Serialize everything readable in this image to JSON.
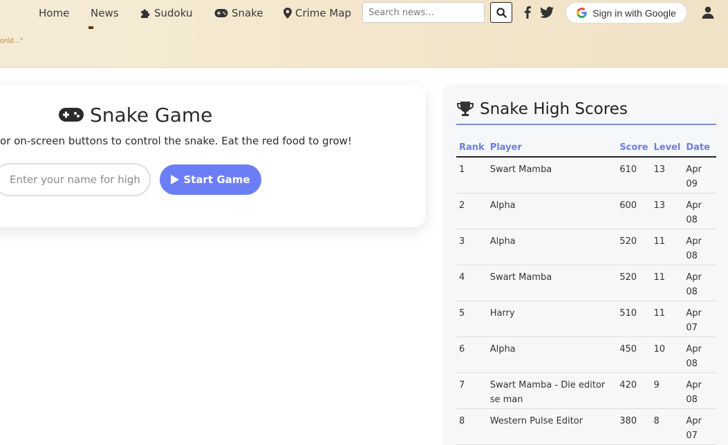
{
  "nav": {
    "home": "Home",
    "news": "News",
    "sudoku": "Sudoku",
    "snake": "Snake",
    "crime_map": "Crime Map",
    "tagline": "orld...\"",
    "search_placeholder": "Search news...",
    "google_signin": "Sign in with Google"
  },
  "game": {
    "title": "Snake Game",
    "instructions": "or on-screen buttons to control the snake. Eat the red food to grow!",
    "name_placeholder": "Enter your name for high scores",
    "start_label": "Start Game",
    "accent_color": "#6c7ef5"
  },
  "scores": {
    "title": "Snake High Scores",
    "columns": [
      "Rank",
      "Player",
      "Score",
      "Level",
      "Date"
    ],
    "rows": [
      {
        "rank": "1",
        "player": "Swart Mamba",
        "score": "610",
        "level": "13",
        "date": "Apr 09"
      },
      {
        "rank": "2",
        "player": "Alpha",
        "score": "600",
        "level": "13",
        "date": "Apr 08"
      },
      {
        "rank": "3",
        "player": "Alpha",
        "score": "520",
        "level": "11",
        "date": "Apr 08"
      },
      {
        "rank": "4",
        "player": "Swart Mamba",
        "score": "520",
        "level": "11",
        "date": "Apr 08"
      },
      {
        "rank": "5",
        "player": "Harry",
        "score": "510",
        "level": "11",
        "date": "Apr 07"
      },
      {
        "rank": "6",
        "player": "Alpha",
        "score": "450",
        "level": "10",
        "date": "Apr 08"
      },
      {
        "rank": "7",
        "player": "Swart Mamba - Die editor se man",
        "score": "420",
        "level": "9",
        "date": "Apr 08"
      },
      {
        "rank": "8",
        "player": "Western Pulse Editor",
        "score": "380",
        "level": "8",
        "date": "Apr 07"
      }
    ]
  },
  "icons": {
    "sudoku": "puzzle-piece-icon",
    "snake": "gamepad-icon",
    "crime_map": "map-marker-icon",
    "search": "search-icon",
    "facebook": "facebook-icon",
    "twitter": "twitter-icon",
    "google": "google-icon",
    "user": "user-icon",
    "trophy": "trophy-icon",
    "play": "play-icon"
  }
}
